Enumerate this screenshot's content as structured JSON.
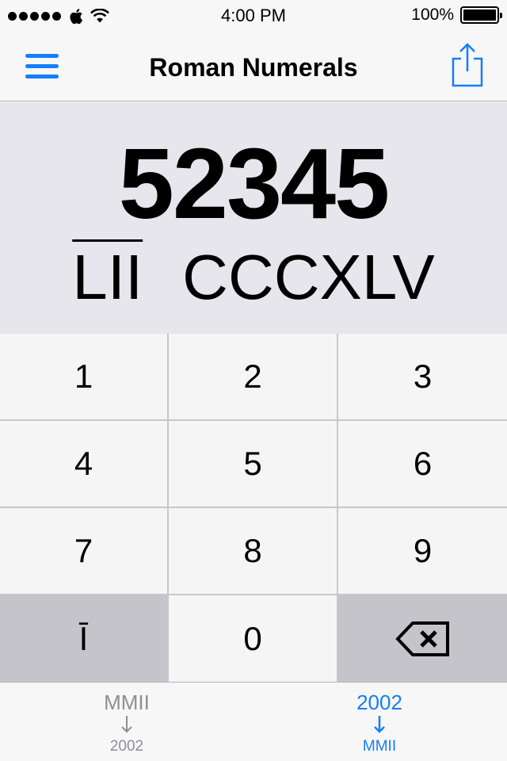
{
  "status_bar": {
    "time": "4:00 PM",
    "battery": "100%",
    "signal_bars": 5,
    "carrier_icon": "apple-icon",
    "wifi_icon": "wifi-icon"
  },
  "nav": {
    "title": "Roman Numerals",
    "menu_icon": "hamburger-icon",
    "share_icon": "share-icon"
  },
  "display": {
    "arabic_value": "52345",
    "roman_overlined": "LII",
    "roman_plain": "CCCXLV"
  },
  "keypad": {
    "keys": [
      "1",
      "2",
      "3",
      "4",
      "5",
      "6",
      "7",
      "8",
      "9",
      "Ī",
      "0"
    ],
    "backspace_icon": "backspace-icon"
  },
  "tabs": {
    "left": {
      "top": "MMII",
      "bottom": "2002"
    },
    "right": {
      "top": "2002",
      "bottom": "MMII"
    }
  },
  "colors": {
    "accent": "#157efb",
    "inactive": "#8e8e93",
    "display_bg": "#e6e6ec",
    "dark_key": "#c4c4ca"
  }
}
